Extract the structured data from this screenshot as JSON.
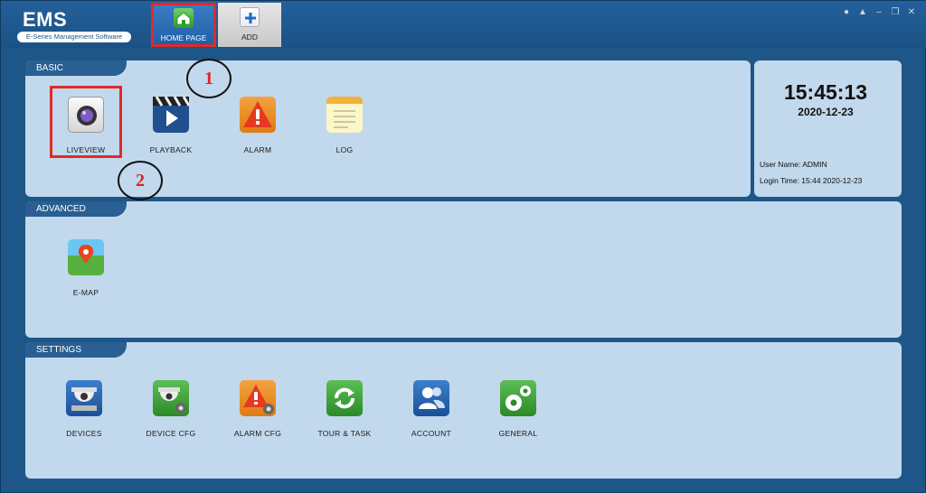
{
  "app": {
    "logo_title": "EMS",
    "logo_subtitle": "E-Series Management Software"
  },
  "tabs": [
    {
      "label": "HOME PAGE",
      "icon": "home-icon",
      "active": true
    },
    {
      "label": "ADD",
      "icon": "plus-icon",
      "active": false
    }
  ],
  "window_controls": [
    "user-icon",
    "lock-icon",
    "minimize-icon",
    "restore-icon",
    "close-icon"
  ],
  "basic": {
    "header": "BASIC",
    "items": [
      {
        "label": "LIVEVIEW",
        "icon": "camera-icon"
      },
      {
        "label": "PLAYBACK",
        "icon": "clapperboard-icon"
      },
      {
        "label": "ALARM",
        "icon": "warning-icon"
      },
      {
        "label": "LOG",
        "icon": "notepad-icon"
      }
    ]
  },
  "status": {
    "time": "15:45:13",
    "date": "2020-12-23",
    "user_name": "User Name: ADMIN",
    "login_time": "Login Time: 15:44 2020-12-23"
  },
  "advanced": {
    "header": "ADVANCED",
    "items": [
      {
        "label": "E-MAP",
        "icon": "map-pin-icon"
      }
    ]
  },
  "settings": {
    "header": "SETTINGS",
    "items": [
      {
        "label": "DEVICES",
        "icon": "dome-camera-icon"
      },
      {
        "label": "DEVICE CFG",
        "icon": "dome-camera-gear-icon"
      },
      {
        "label": "ALARM CFG",
        "icon": "warning-gear-icon"
      },
      {
        "label": "TOUR & TASK",
        "icon": "refresh-icon"
      },
      {
        "label": "ACCOUNT",
        "icon": "users-icon"
      },
      {
        "label": "GENERAL",
        "icon": "gears-icon"
      }
    ]
  },
  "annotations": [
    "1",
    "2"
  ],
  "colors": {
    "background": "#1e5687",
    "panel": "#c2d8ec",
    "panel_header": "#295f92",
    "highlight": "#e02a2a",
    "annotation_text": "#d8262a"
  }
}
